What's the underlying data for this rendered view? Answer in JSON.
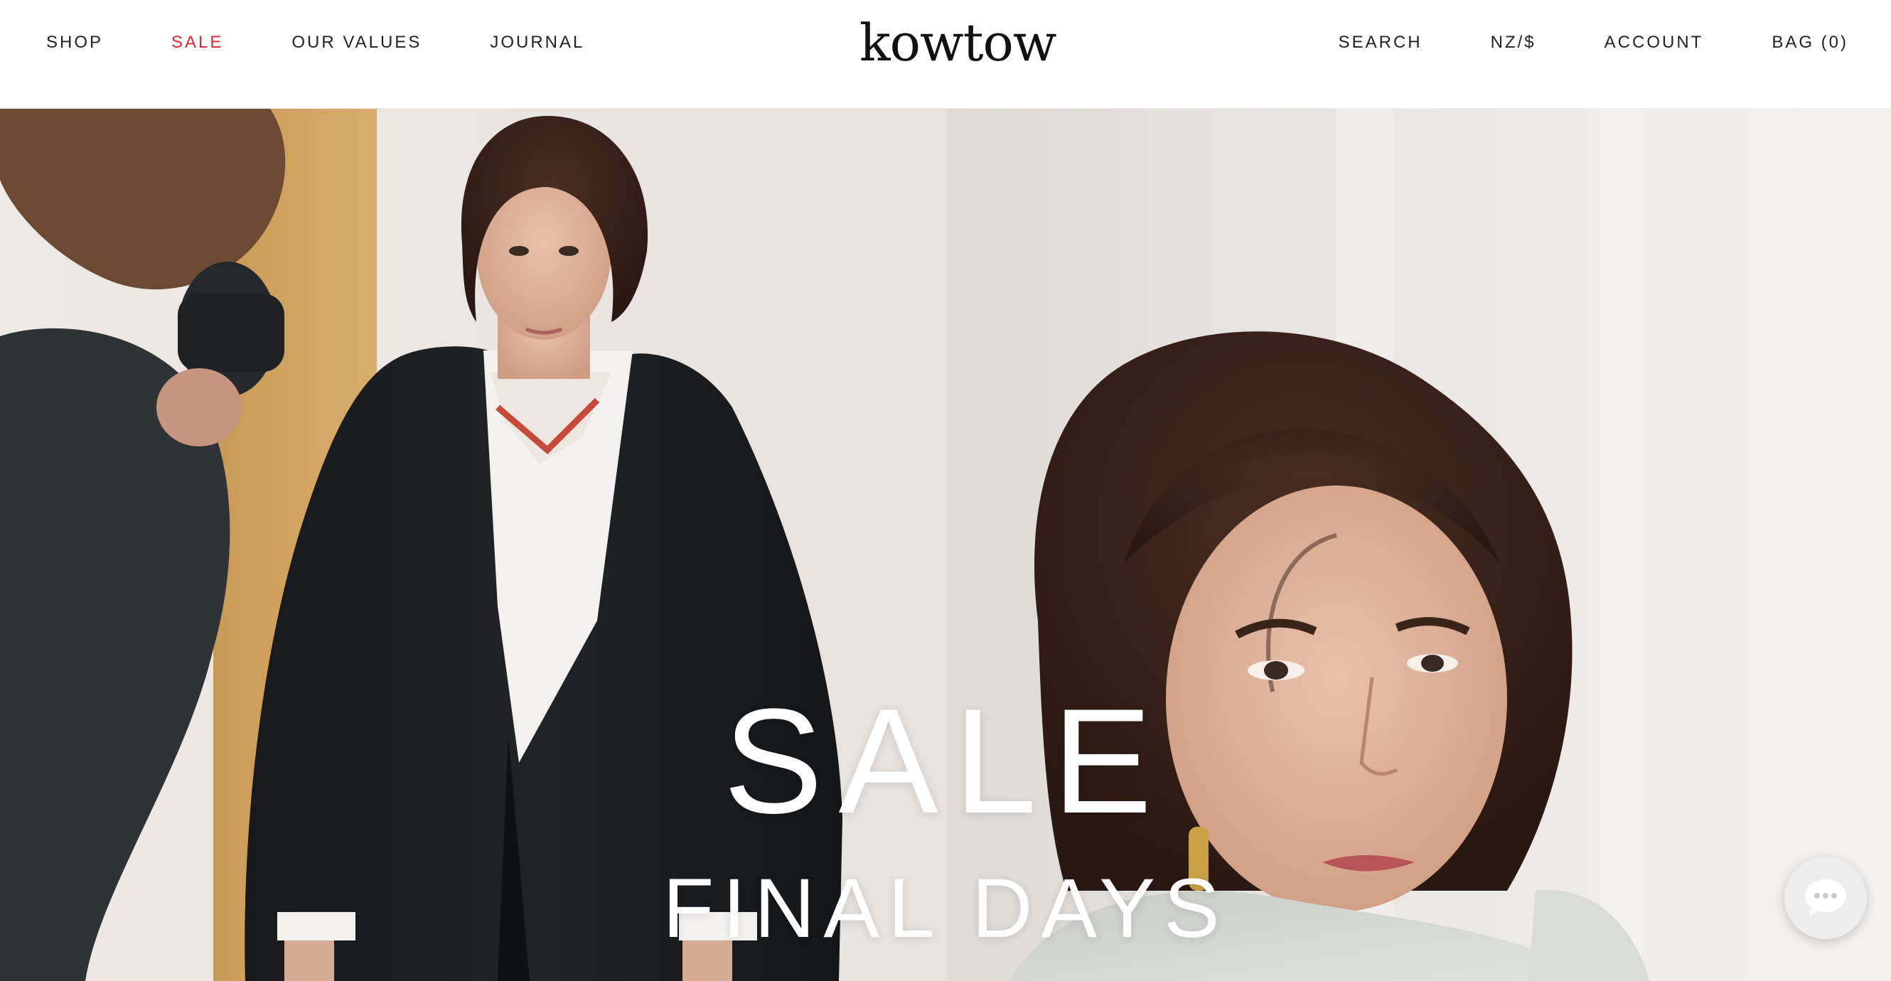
{
  "header": {
    "nav_left": [
      "SHOP",
      "SALE",
      "OUR VALUES",
      "JOURNAL"
    ],
    "logo": "kowtow",
    "nav_right": [
      "SEARCH",
      "NZ/$",
      "ACCOUNT",
      "BAG (0)"
    ]
  },
  "hero": {
    "headline": "SALE",
    "subheadline": "FINAL DAYS"
  },
  "colors": {
    "sale_accent": "#e0262f",
    "hero_text": "#ffffff"
  },
  "icons": {
    "chat": "chat-bubble-icon"
  }
}
